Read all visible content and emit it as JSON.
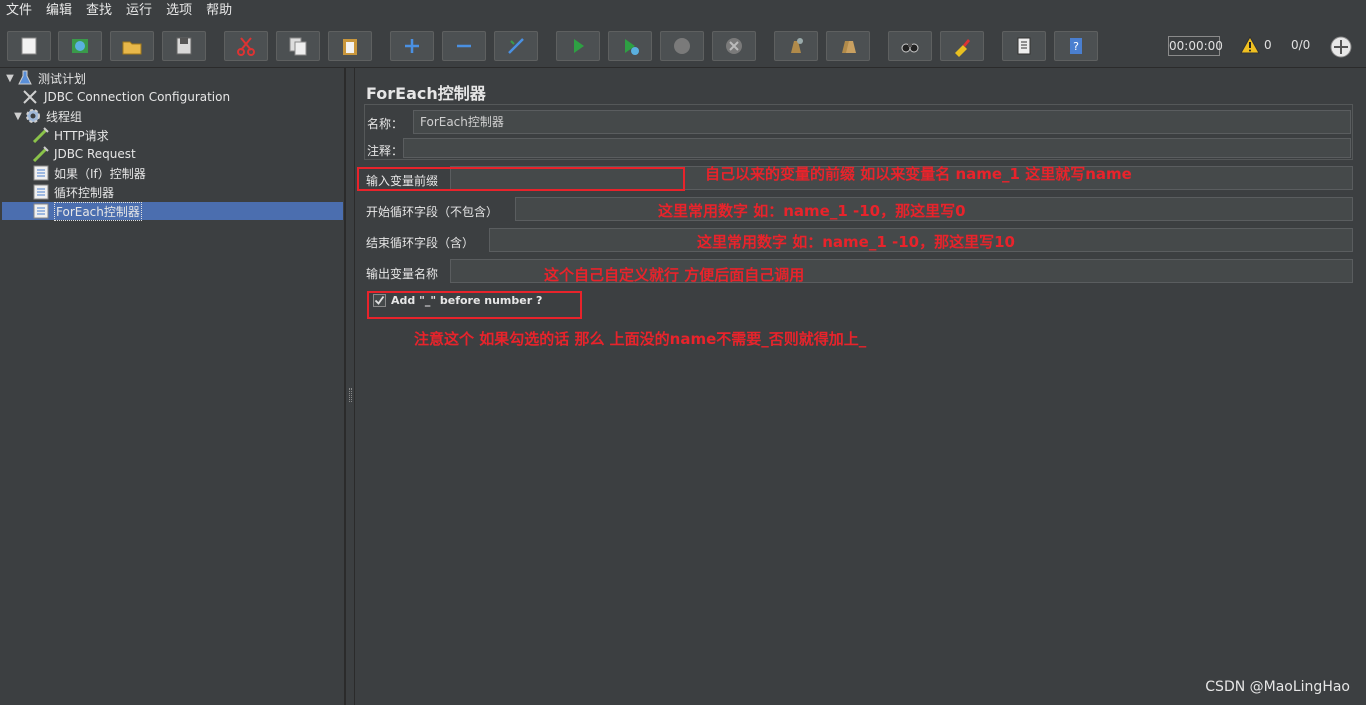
{
  "menu": [
    "文件",
    "编辑",
    "查找",
    "运行",
    "选项",
    "帮助"
  ],
  "toolbar": {
    "buttons": [
      "new-icon",
      "templates-icon",
      "open-icon",
      "save-icon",
      "cut-icon",
      "copy-icon",
      "paste-icon",
      "expand-icon",
      "collapse-icon",
      "toggle-icon",
      "start-icon",
      "start-no-pause-icon",
      "stop-icon",
      "shutdown-icon",
      "clear-icon",
      "clear-all-icon",
      "search-icon",
      "reset-search-icon",
      "function-helper-icon",
      "help-icon"
    ],
    "timer": "00:00:00",
    "warnings": "0",
    "threads": "0/0"
  },
  "tree": {
    "nodes": [
      {
        "label": "测试计划",
        "icon": "test-plan-icon",
        "expanded": true
      },
      {
        "label": "JDBC Connection Configuration",
        "icon": "config-icon"
      },
      {
        "label": "线程组",
        "icon": "thread-group-icon",
        "expanded": true
      },
      {
        "label": "HTTP请求",
        "icon": "sampler-icon"
      },
      {
        "label": "JDBC Request",
        "icon": "sampler-icon"
      },
      {
        "label": "如果（If）控制器",
        "icon": "controller-icon"
      },
      {
        "label": "循环控制器",
        "icon": "controller-icon"
      },
      {
        "label": "ForEach控制器",
        "icon": "controller-icon",
        "selected": true
      }
    ]
  },
  "panel": {
    "title": "ForEach控制器",
    "name_label": "名称：",
    "name_value": "ForEach控制器",
    "comment_label": "注释：",
    "comment_value": "",
    "input_prefix_label": "输入变量前缀",
    "input_prefix_value": "",
    "start_label": "开始循环字段（不包含）",
    "start_value": "",
    "end_label": "结束循环字段（含）",
    "end_value": "",
    "output_label": "输出变量名称",
    "output_value": "",
    "add_underscore_label": "Add \"_\" before number ?",
    "add_underscore_checked": true
  },
  "annotations": {
    "a1": "自己以来的变量的前缀    如以来变量名  name_1 这里就写name",
    "a2": "这里常用数字  如：name_1 -10，那这里写0",
    "a3": "这里常用数字  如：name_1 -10，那这里写10",
    "a4": "这个自己自定义就行  方便后面自己调用",
    "a5": "注意这个  如果勾选的话  那么 上面没的name不需要_否则就得加上_"
  },
  "watermark": "CSDN @MaoLingHao",
  "colors": {
    "accent": "#e8232b",
    "selection": "#4b6eaf",
    "background": "#3c3f41"
  }
}
